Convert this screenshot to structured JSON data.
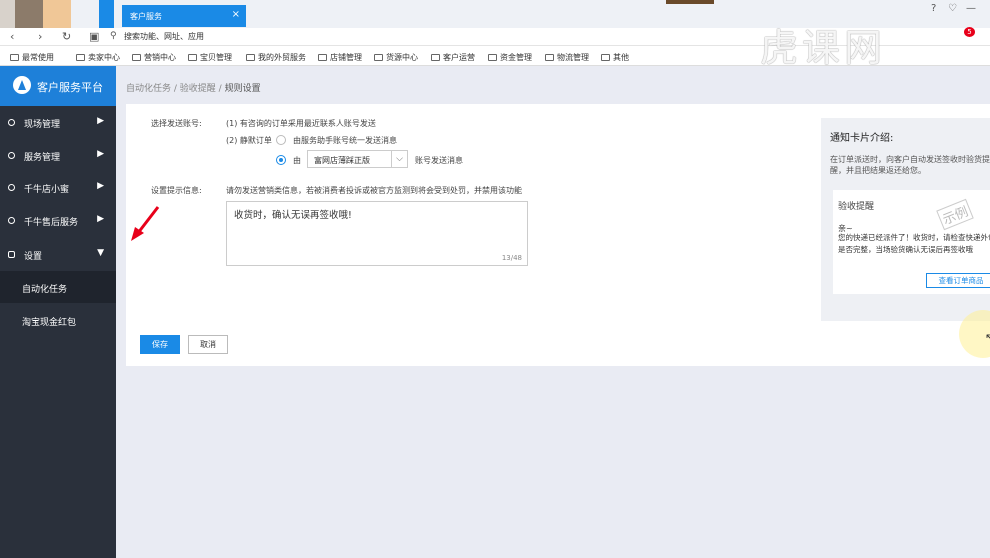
{
  "browser": {
    "tab_title": "客户服务",
    "tab_close": "×",
    "address_placeholder": "搜索功能、网址、应用",
    "bookmarks": [
      "最常使用",
      "卖家中心",
      "营销中心",
      "宝贝管理",
      "我的外贸服务",
      "店铺管理",
      "货源中心",
      "客户运营",
      "资金管理",
      "物流管理",
      "其他"
    ],
    "notification_count": "5",
    "watermark": "虎课网"
  },
  "sidebar": {
    "brand": "客户服务平台",
    "menus": [
      {
        "label": "现场管理",
        "arrow": "▶"
      },
      {
        "label": "服务管理",
        "arrow": "▶"
      },
      {
        "label": "千牛店小蜜",
        "arrow": "▶"
      },
      {
        "label": "千牛售后服务",
        "arrow": "▶"
      },
      {
        "label": "设置",
        "arrow": "▼"
      }
    ],
    "subitems": [
      "自动化任务",
      "淘宝现金红包"
    ]
  },
  "breadcrumb": {
    "part1": "自动化任务",
    "sep": " / ",
    "part2": "验收提醒",
    "current": "规则设置"
  },
  "form": {
    "account_label": "选择发送账号:",
    "rule1": "(1) 有咨询的订单采用最近联系人账号发送",
    "rule2": "(2) 静默订单",
    "option1": "由服务助手账号统一发送消息",
    "option2_prefix": "由",
    "select_value": "富网店薄踩正版",
    "option2_suffix": "账号发送消息",
    "tip_label": "设置提示信息:",
    "tip_warning": "请勿发送营销类信息，若被消费者投诉或被官方监测到将会受到处罚，并禁用该功能",
    "message_value": "收货时，确认无误再签收哦!",
    "char_count": "13/48",
    "save_label": "保存",
    "cancel_label": "取消"
  },
  "panel": {
    "title": "通知卡片介绍:",
    "description": "在订单派送时，向客户自动发送签收时验货提醒，并且把结果返还给您。",
    "card_title": "验收提醒",
    "stamp": "示例",
    "greeting": "亲~",
    "body": "您的快递已经派件了！收货时，请检查快递外包装是否完整，当场验货确认无误后再签收哦",
    "button": "查看订单商品"
  },
  "colors": {
    "accent": "#1a8ae6",
    "sidebar_bg": "#2a303b",
    "main_bg": "#e9ebf3",
    "arrow": "#e8001a"
  }
}
